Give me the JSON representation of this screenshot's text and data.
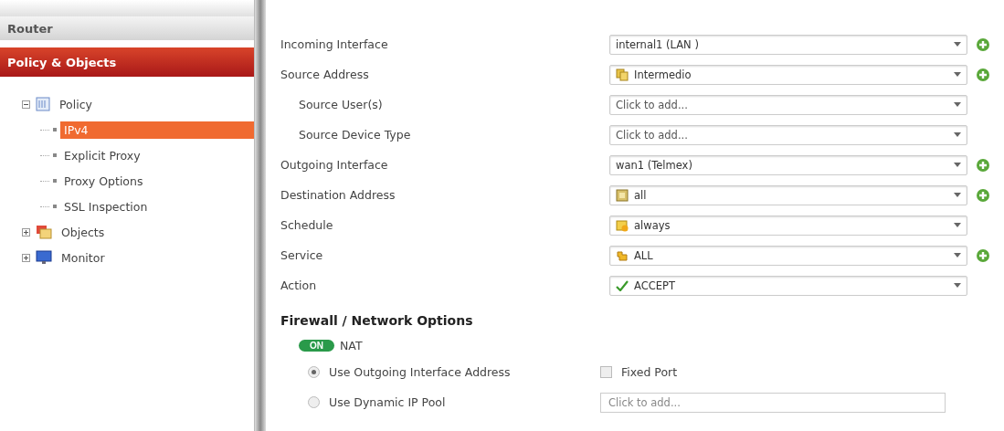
{
  "sidebar": {
    "sections": [
      {
        "label": "Router",
        "selected": false
      },
      {
        "label": "Policy & Objects",
        "selected": true
      }
    ],
    "tree": [
      {
        "label": "Policy",
        "kind": "list",
        "expanded": true,
        "selected": false,
        "children": [
          {
            "label": "IPv4",
            "selected": true
          },
          {
            "label": "Explicit Proxy",
            "selected": false
          },
          {
            "label": "Proxy Options",
            "selected": false
          },
          {
            "label": "SSL Inspection",
            "selected": false
          }
        ]
      },
      {
        "label": "Objects",
        "kind": "objects",
        "expanded": false,
        "selected": false
      },
      {
        "label": "Monitor",
        "kind": "monitor",
        "expanded": false,
        "selected": false
      }
    ]
  },
  "form": {
    "fields": [
      {
        "label": "Incoming Interface",
        "indent": false,
        "value": "internal1 (LAN )",
        "kind": "plain",
        "add": true
      },
      {
        "label": "Source Address",
        "indent": false,
        "value": "Intermedio",
        "kind": "address",
        "add": true
      },
      {
        "label": "Source User(s)",
        "indent": true,
        "placeholder": "Click to add...",
        "kind": "plain",
        "add": false
      },
      {
        "label": "Source Device Type",
        "indent": true,
        "placeholder": "Click to add...",
        "kind": "plain",
        "add": false
      },
      {
        "label": "Outgoing Interface",
        "indent": false,
        "value": "wan1 (Telmex)",
        "kind": "plain",
        "add": true
      },
      {
        "label": "Destination Address",
        "indent": false,
        "value": "all",
        "kind": "object",
        "add": true
      },
      {
        "label": "Schedule",
        "indent": false,
        "value": "always",
        "kind": "schedule",
        "add": false
      },
      {
        "label": "Service",
        "indent": false,
        "value": "ALL",
        "kind": "service",
        "add": true
      },
      {
        "label": "Action",
        "indent": false,
        "value": "ACCEPT",
        "kind": "action",
        "add": false
      }
    ]
  },
  "firewall": {
    "title": "Firewall / Network Options",
    "nat": {
      "on": true,
      "toggle_text": "ON",
      "label": "NAT"
    },
    "options": [
      {
        "label": "Use Outgoing Interface Address",
        "selected": true
      },
      {
        "label": "Use Dynamic IP Pool",
        "selected": false
      }
    ],
    "fixed_port": {
      "label": "Fixed Port",
      "checked": false
    },
    "ip_pool": {
      "placeholder": "Click to add..."
    }
  }
}
